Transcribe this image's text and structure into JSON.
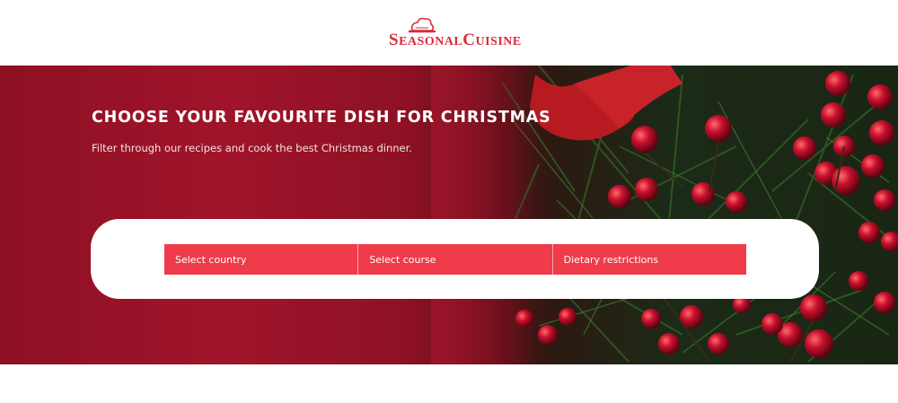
{
  "header": {
    "logo": {
      "word1_initial": "S",
      "word1_rest": "EASONAL",
      "word2_initial": "C",
      "word2_rest": "UISINE",
      "icon": "chef-hat-icon",
      "color": "#d92b3a"
    }
  },
  "hero": {
    "title": "CHOOSE YOUR FAVOURITE DISH FOR CHRISTMAS",
    "subtitle": "Filter through our recipes and cook the best Christmas dinner.",
    "background_color": "#a0142a"
  },
  "filters": {
    "accent_color": "#ef3b4a",
    "country": "Select country",
    "course": "Select course",
    "dietary": "Dietary restrictions"
  }
}
